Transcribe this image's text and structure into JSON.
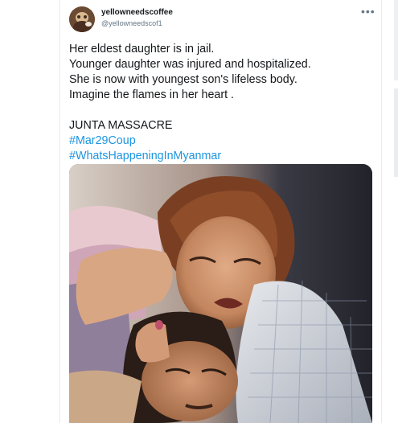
{
  "tweet": {
    "display_name": "yellowneedscoffee",
    "handle": "@yellowneedscof1",
    "more_icon": "more-icon",
    "lines": [
      "Her eldest daughter is in jail.",
      "Younger daughter was injured and hospitalized.",
      "She is now with youngest son's lifeless body.",
      "Imagine the flames in her heart ."
    ],
    "tagline": "JUNTA MASSACRE",
    "hashtags": [
      "#Mar29Coup",
      "#WhatsHappeningInMyanmar"
    ]
  },
  "colors": {
    "text": "#14171a",
    "secondary": "#657786",
    "hashtag": "#1b95e0"
  }
}
